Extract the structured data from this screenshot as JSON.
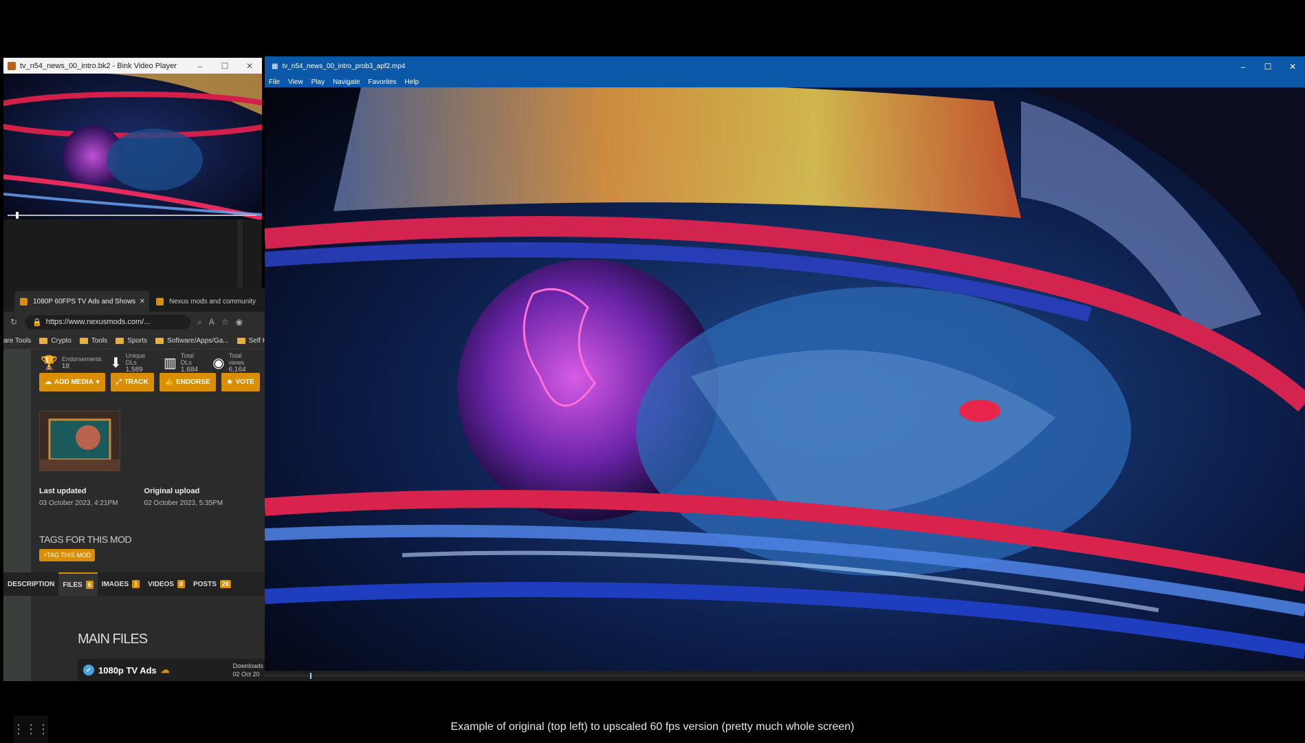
{
  "bink_player": {
    "title": "tv_n54_news_00_intro.bk2 - Bink Video Player",
    "controls": [
      "–",
      "☐",
      "✕"
    ]
  },
  "browser": {
    "tabs": [
      {
        "label": "1080P 60FPS TV Ads and Shows",
        "active": true
      },
      {
        "label": "Nexus mods and community",
        "active": false
      }
    ],
    "url": "https://www.nexusmods.com/...",
    "bookmarks": [
      "are Tools",
      "Crypto",
      "Tools",
      "Sports",
      "Software/Apps/Ga...",
      "Self Ho"
    ],
    "stats": [
      {
        "label": "Endorsements",
        "value": "18",
        "icon": "trophy-icon"
      },
      {
        "label": "Unique DLs",
        "value": "1,589",
        "icon": "download-icon"
      },
      {
        "label": "Total DLs",
        "value": "1,684",
        "icon": "bar-chart-icon"
      },
      {
        "label": "Total views",
        "value": "6,164",
        "icon": "eye-icon"
      }
    ],
    "action_buttons": [
      "ADD MEDIA",
      "TRACK",
      "ENDORSE",
      "VOTE"
    ],
    "last_updated_label": "Last updated",
    "last_updated_value": "03 October 2023,  4:21PM",
    "original_upload_label": "Original upload",
    "original_upload_value": "02 October 2023,  5:35PM",
    "tags_heading": "TAGS FOR THIS MOD",
    "tag_button": "TAG THIS MOD",
    "file_tabs": [
      {
        "label": "DESCRIPTION",
        "badge": ""
      },
      {
        "label": "FILES",
        "badge": "6"
      },
      {
        "label": "IMAGES",
        "badge": "1"
      },
      {
        "label": "VIDEOS",
        "badge": "0"
      },
      {
        "label": "POSTS",
        "badge": "28"
      }
    ],
    "main_files_heading": "MAIN FILES",
    "file_name": "1080p TV Ads",
    "file_download_label": "Downloads",
    "file_date": "02 Oct 20"
  },
  "main_player": {
    "title": "tv_n54_news_00_intro_prob3_apf2.mp4",
    "menu": [
      "File",
      "View",
      "Play",
      "Navigate",
      "Favorites",
      "Help"
    ],
    "controls": [
      "–",
      "☐",
      "✕"
    ]
  },
  "caption": "Example of original (top left) to upscaled 60 fps version (pretty much whole screen)"
}
